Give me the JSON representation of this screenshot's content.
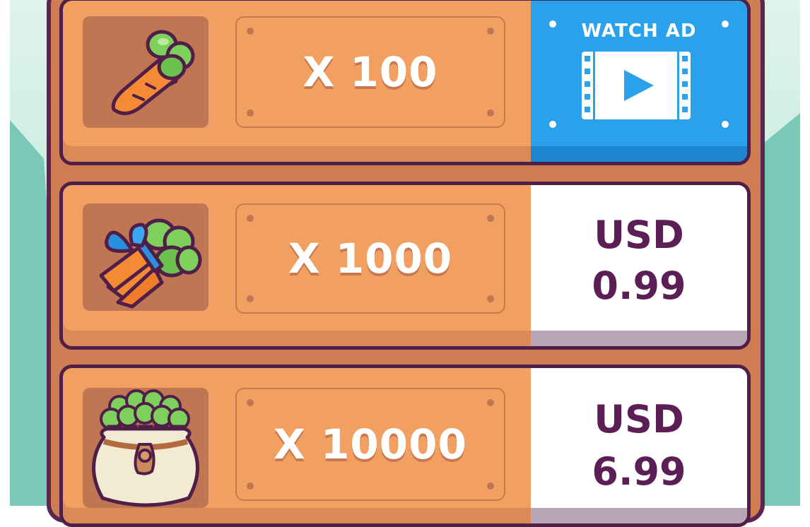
{
  "offers": [
    {
      "quantity_label": "X 100",
      "action_type": "watch_ad",
      "action_label": "WATCH AD",
      "icon": "single-carrot-icon"
    },
    {
      "quantity_label": "X 1000",
      "action_type": "purchase",
      "currency": "USD",
      "price": "0.99",
      "icon": "carrot-bundle-icon"
    },
    {
      "quantity_label": "X 10000",
      "action_type": "purchase",
      "currency": "USD",
      "price": "6.99",
      "icon": "carrot-sack-icon"
    }
  ],
  "colors": {
    "row_orange": "#f2a061",
    "panel_brown": "#cf7d52",
    "outline_purple": "#4f1f4a",
    "ad_blue": "#2aa1ea",
    "price_purple": "#5b1f55"
  }
}
